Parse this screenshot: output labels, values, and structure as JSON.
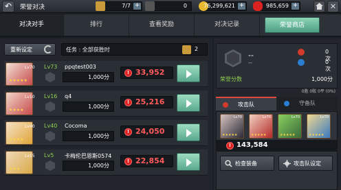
{
  "header": {
    "title": "荣誉对决",
    "resources": [
      {
        "icon": "ticket-icon",
        "value": "7/7",
        "color": "#c99a3a"
      },
      {
        "icon": "blank-icon",
        "value": "0",
        "color": "#777"
      },
      {
        "icon": "gold-coin-icon",
        "value": "76,299,621",
        "color": "#e8b930"
      },
      {
        "icon": "ruby-icon",
        "value": "985,659",
        "color": "#d22"
      }
    ],
    "plus": "+",
    "close": "✕"
  },
  "tabs": [
    {
      "label": "对决对手",
      "active": true
    },
    {
      "label": "排行",
      "active": false
    },
    {
      "label": "查看奖励",
      "active": false
    },
    {
      "label": "对决记录",
      "active": false
    },
    {
      "label": "荣誉商店",
      "active": false
    }
  ],
  "left": {
    "reset_label": "重新设定",
    "mission_label": "任务 : 全部获胜时",
    "mission_count": "2",
    "opponents": [
      {
        "level": "Lv73",
        "portrait_level": "Lv70",
        "name": "ppqtest003",
        "points": "1,000分",
        "power": "33,952",
        "stars": "★★★★★",
        "colors": [
          "#c74b4b",
          "#f2e0d6"
        ]
      },
      {
        "level": "Lv16",
        "portrait_level": "Lv10",
        "name": "q4",
        "points": "1,000分",
        "power": "25,216",
        "stars": "★★★★",
        "colors": [
          "#c74b4b",
          "#f0d5c8"
        ]
      },
      {
        "level": "Lv40",
        "portrait_level": "Lv40",
        "name": "Cocoma",
        "points": "1,000分",
        "power": "24,050",
        "stars": "★★★★",
        "colors": [
          "#e0a53a",
          "#f5e1c5"
        ]
      },
      {
        "level": "Lv5",
        "portrait_level": "Lv15",
        "name": "卡梅伦巴恩斯0574",
        "points": "1,000分",
        "power": "22,854",
        "stars": "★★★",
        "colors": [
          "#d9a948",
          "#f0d9b8"
        ]
      }
    ]
  },
  "right": {
    "rank_name": "--",
    "rank_sub": "--",
    "stats": [
      {
        "icon": "red-orb-icon",
        "value": "0次",
        "color": "#d23a2a"
      },
      {
        "icon": "blue-orb-icon",
        "value": "0次",
        "color": "#2a7ed2"
      }
    ],
    "honor_label": "荣誉分数",
    "honor_value": "1,000分",
    "record": "0胜 0败 0平 (0%)",
    "team_tabs": [
      "攻击队",
      "守备队"
    ],
    "heroes": [
      {
        "level": "Lv70",
        "stars": "★★★★★",
        "colors": [
          "#2a2a38",
          "#d8c4c0"
        ]
      },
      {
        "level": "Lv70",
        "stars": "★★★★★",
        "colors": [
          "#b52a2a",
          "#f0d0c0"
        ]
      },
      {
        "level": "Lv70",
        "stars": "★★★★★",
        "colors": [
          "#3a6a3a",
          "#8ad060"
        ]
      },
      {
        "level": "Lv70",
        "stars": "★★★★★",
        "colors": [
          "#3a7ac0",
          "#f0d890"
        ]
      }
    ],
    "team_power": "143,584",
    "buttons": [
      {
        "icon": "magnifier-icon",
        "label": "检查装备"
      },
      {
        "icon": "gear-icon",
        "label": "攻击队设定"
      }
    ]
  }
}
